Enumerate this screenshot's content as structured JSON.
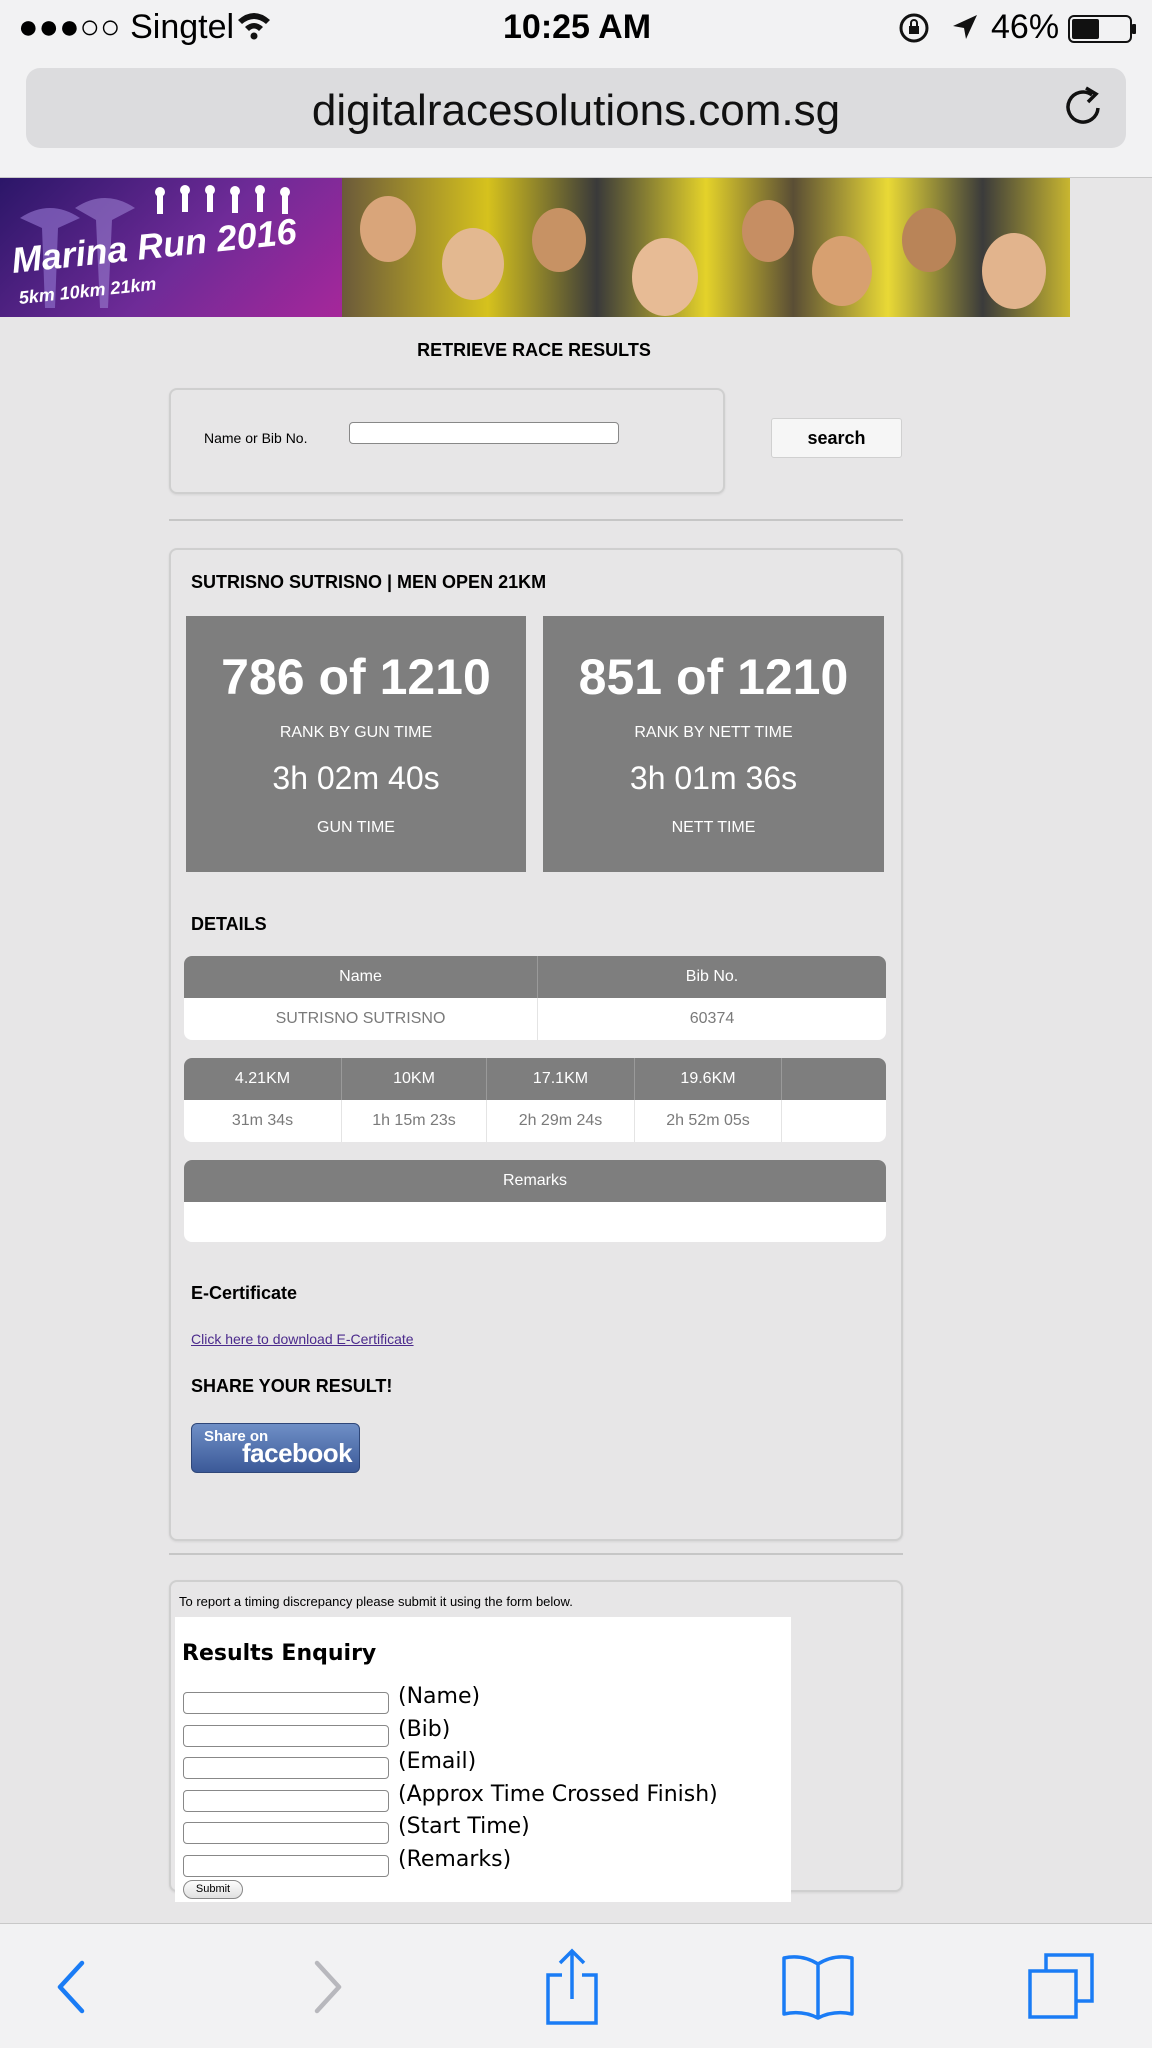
{
  "status_bar": {
    "carrier": "●●●○○ Singtel",
    "time": "10:25 AM",
    "battery": "46%"
  },
  "browser": {
    "url": "digitalracesolutions.com.sg"
  },
  "banner": {
    "title": "Marina Run 2016",
    "subtitle": "5km 10km 21km"
  },
  "search": {
    "heading": "RETRIEVE RACE RESULTS",
    "label": "Name or Bib No.",
    "value": "",
    "button": "search"
  },
  "result": {
    "title": "SUTRISNO SUTRISNO | MEN OPEN 21KM",
    "gun": {
      "rank": "786 of 1210",
      "rank_label": "RANK BY GUN TIME",
      "time": "3h 02m 40s",
      "time_label": "GUN TIME"
    },
    "nett": {
      "rank": "851 of 1210",
      "rank_label": "RANK BY NETT TIME",
      "time": "3h 01m 36s",
      "time_label": "NETT TIME"
    },
    "details_heading": "DETAILS",
    "details": {
      "headers": [
        "Name",
        "Bib No."
      ],
      "values": [
        "SUTRISNO SUTRISNO",
        "60374"
      ]
    },
    "splits": {
      "headers": [
        "4.21KM",
        "10KM",
        "17.1KM",
        "19.6KM",
        ""
      ],
      "values": [
        "31m 34s",
        "1h 15m 23s",
        "2h 29m 24s",
        "2h 52m 05s",
        ""
      ]
    },
    "remarks": {
      "header": "Remarks",
      "value": ""
    },
    "ecert_heading": "E-Certificate",
    "ecert_link": "Click here to download E-Certificate",
    "share_heading": "SHARE YOUR RESULT!",
    "facebook": {
      "small": "Share on",
      "big": "facebook"
    }
  },
  "enquiry": {
    "note": "To report a timing discrepancy please submit it using the form below.",
    "title": "Results Enquiry",
    "fields": [
      {
        "label": "(Name)",
        "value": ""
      },
      {
        "label": "(Bib)",
        "value": ""
      },
      {
        "label": "(Email)",
        "value": ""
      },
      {
        "label": "(Approx Time Crossed Finish)",
        "value": ""
      },
      {
        "label": "(Start Time)",
        "value": ""
      },
      {
        "label": "(Remarks)",
        "value": ""
      }
    ],
    "submit": "Submit"
  },
  "toolbar": {
    "icons": [
      "back-icon",
      "forward-icon",
      "share-icon",
      "bookmarks-icon",
      "tabs-icon"
    ]
  }
}
